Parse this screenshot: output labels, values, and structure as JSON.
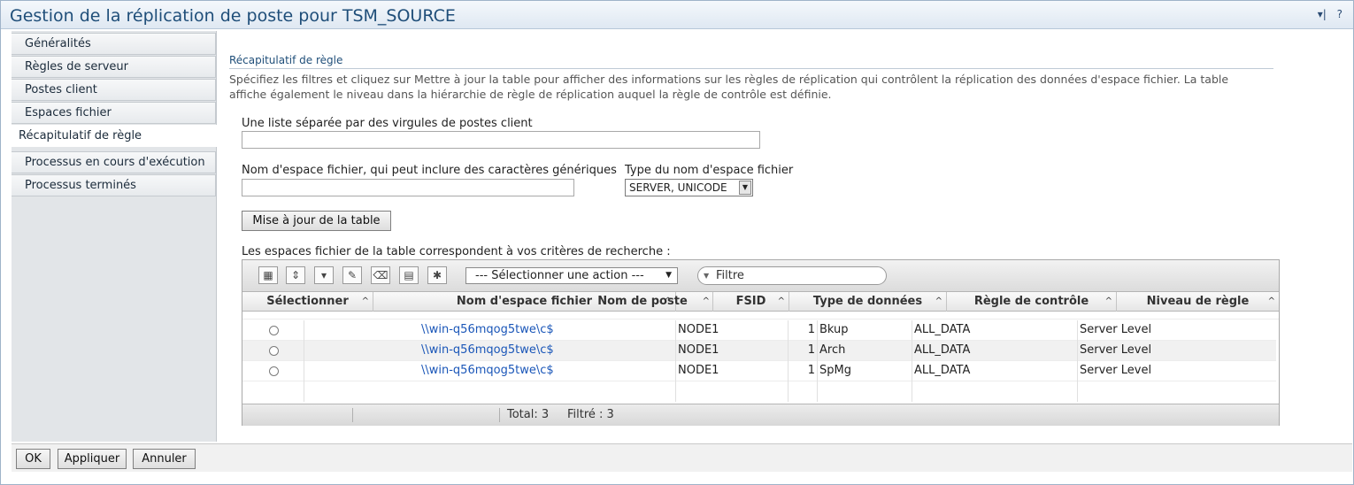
{
  "window": {
    "title": "Gestion de la réplication de poste pour TSM_SOURCE",
    "action_menu": "▾|",
    "help": "?"
  },
  "sidebar": {
    "items": [
      {
        "label": "Généralités",
        "active": false
      },
      {
        "label": "Règles de serveur",
        "active": false
      },
      {
        "label": "Postes client",
        "active": false
      },
      {
        "label": "Espaces fichier",
        "active": false
      },
      {
        "label": "Récapitulatif de règle",
        "active": true
      },
      {
        "label": "Processus en cours d'exécution",
        "active": false
      },
      {
        "label": "Processus terminés",
        "active": false
      }
    ]
  },
  "main": {
    "section_title": "Récapitulatif de règle",
    "description": "Spécifiez les filtres et cliquez sur Mettre à jour la table pour afficher des informations sur les règles de réplication qui contrôlent la réplication des données d'espace fichier. La table affiche également le niveau dans la hiérarchie de règle de réplication auquel la règle de contrôle est définie.",
    "client_list_label": "Une liste séparée par des virgules de postes client",
    "client_list_value": "",
    "fs_name_label": "Nom d'espace fichier, qui peut inclure des caractères génériques",
    "fs_name_value": "",
    "fs_type_label": "Type du nom d'espace fichier",
    "fs_type_value": "SERVER, UNICODE",
    "update_button": "Mise à jour de la table",
    "results_label": "Les espaces fichier de la table correspondent à vos critères de recherche :"
  },
  "table": {
    "toolbar": {
      "icons": [
        "table-icon",
        "collapse-icon",
        "expand-filter-icon",
        "edit-icon",
        "clear-icon",
        "export-icon",
        "settings-icon"
      ],
      "action_select": "--- Sélectionner une action ---",
      "filter_placeholder": "Filtre"
    },
    "columns": [
      "Sélectionner",
      "Nom d'espace fichier",
      "Nom de poste",
      "FSID",
      "Type de données",
      "Règle de contrôle",
      "Niveau de règle"
    ],
    "rows": [
      {
        "fs_name": "\\\\win-q56mqog5twe\\c$",
        "node": "NODE1",
        "fsid": "1",
        "data_type": "Bkup",
        "rule": "ALL_DATA",
        "level": "Server Level"
      },
      {
        "fs_name": "\\\\win-q56mqog5twe\\c$",
        "node": "NODE1",
        "fsid": "1",
        "data_type": "Arch",
        "rule": "ALL_DATA",
        "level": "Server Level"
      },
      {
        "fs_name": "\\\\win-q56mqog5twe\\c$",
        "node": "NODE1",
        "fsid": "1",
        "data_type": "SpMg",
        "rule": "ALL_DATA",
        "level": "Server Level"
      }
    ],
    "footer": {
      "total": "Total: 3",
      "filtered": "Filtré : 3"
    }
  },
  "footer_buttons": {
    "ok": "OK",
    "apply": "Appliquer",
    "cancel": "Annuler"
  }
}
